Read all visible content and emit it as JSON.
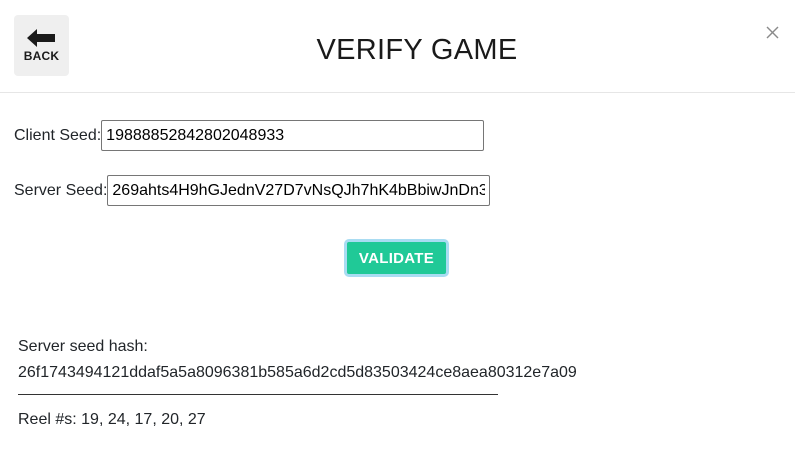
{
  "header": {
    "back_label": "BACK",
    "title": "VERIFY GAME"
  },
  "form": {
    "client_seed_label": "Client Seed:",
    "client_seed_value": "19888852842802048933",
    "server_seed_label": "Server Seed:",
    "server_seed_value": "269ahts4H9hGJednV27D7vNsQJh7hK4bBbiwJnDn3",
    "validate_label": "VALIDATE"
  },
  "result": {
    "hash_label": "Server seed hash:",
    "hash_value": "26f1743494121ddaf5a5a8096381b585a6d2cd5d83503424ce8aea80312e7a09",
    "reels_line": "Reel #s: 19, 24, 17, 20, 27"
  },
  "colors": {
    "accent": "#20c997",
    "focus_ring": "#a9dcf2",
    "back_button_bg": "#efefef"
  },
  "icons": {
    "back": "back-arrow-icon",
    "close": "close-icon"
  }
}
